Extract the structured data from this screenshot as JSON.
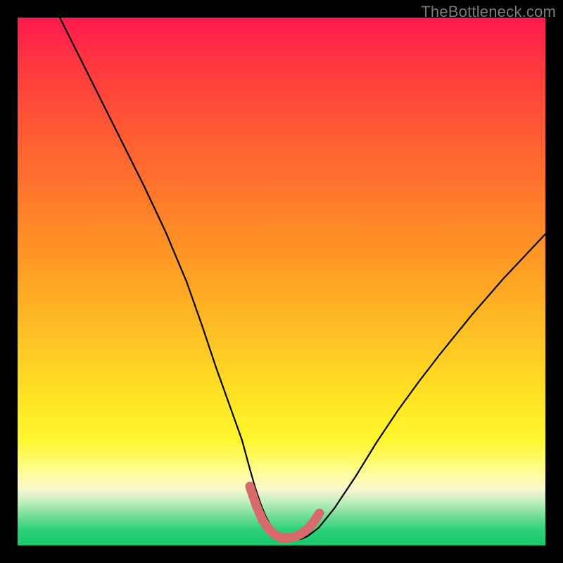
{
  "watermark": "TheBottleneck.com",
  "colors": {
    "frame": "#000000",
    "curve": "#000000",
    "markers": "#d86a6a",
    "gradient_top": "#ff1a4e",
    "gradient_bottom": "#16c86c"
  },
  "chart_data": {
    "type": "line",
    "title": "",
    "xlabel": "",
    "ylabel": "",
    "xlim": [
      0,
      100
    ],
    "ylim": [
      0,
      100
    ],
    "series": [
      {
        "name": "bottleneck-curve",
        "x": [
          8,
          12,
          16,
          20,
          24,
          28,
          32,
          35,
          37.5,
          40,
          42.5,
          44,
          45,
          46,
          47,
          48,
          49,
          50,
          51,
          52,
          53,
          54,
          55,
          57,
          60,
          64,
          68,
          72,
          76,
          80,
          86,
          92,
          100
        ],
        "y": [
          100,
          92,
          84,
          76,
          68,
          59.5,
          50,
          41.5,
          34,
          27,
          20,
          14.5,
          11,
          8,
          5.5,
          3.7,
          2.4,
          1.6,
          1.2,
          1.1,
          1.1,
          1.3,
          1.8,
          3.3,
          7,
          13,
          19.5,
          25.5,
          31,
          36.2,
          43.6,
          50.5,
          59
        ]
      }
    ],
    "markers": {
      "name": "trough-markers",
      "x": [
        44,
        45.2,
        46.4,
        47.6,
        48.8,
        50,
        51.2,
        52.4,
        53.6,
        54.8,
        56,
        57.2
      ],
      "y": [
        11.2,
        7.6,
        4.8,
        3.1,
        2.0,
        1.4,
        1.4,
        1.6,
        2.1,
        3.0,
        4.3,
        6.1
      ]
    }
  }
}
